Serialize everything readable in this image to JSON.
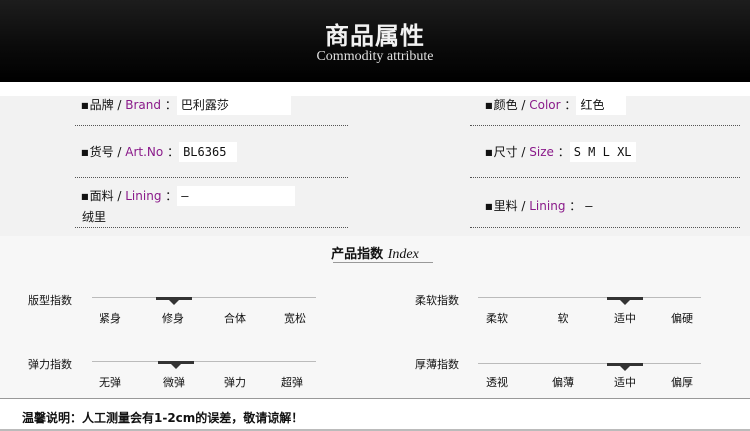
{
  "header": {
    "title": "商品属性",
    "subtitle": "Commodity attribute"
  },
  "attributes": {
    "bullet": "■",
    "brand": {
      "cn": "品牌",
      "sep": " / ",
      "en": "Brand",
      "colon": "：",
      "value": "巴利露莎"
    },
    "color": {
      "cn": "颜色",
      "sep": " / ",
      "en": "Color",
      "colon": "：",
      "value": "红色"
    },
    "art": {
      "cn": "货号",
      "sep": " / ",
      "en": "Art.No",
      "colon": "：",
      "value": "BL6365"
    },
    "size": {
      "cn": "尺寸",
      "sep": " / ",
      "en": "Size",
      "colon": "：",
      "value": "S M L XL"
    },
    "fabric": {
      "cn": "面料",
      "sep": " / ",
      "en": "Lining",
      "colon": "：",
      "value": "–",
      "value_cont": "绒里"
    },
    "lining": {
      "cn": "里料",
      "sep": " / ",
      "en": "Lining",
      "colon": "：",
      "value": "–"
    }
  },
  "index": {
    "title_cn": "产品指数",
    "title_en": "Index",
    "rows": [
      {
        "label": "版型指数",
        "options": [
          "紧身",
          "修身",
          "合体",
          "宽松"
        ],
        "selected": 1
      },
      {
        "label": "柔软指数",
        "options": [
          "柔软",
          "软",
          "适中",
          "偏硬"
        ],
        "selected": 2
      },
      {
        "label": "弹力指数",
        "options": [
          "无弹",
          "微弹",
          "弹力",
          "超弹"
        ],
        "selected": 1
      },
      {
        "label": "厚薄指数",
        "options": [
          "透视",
          "偏薄",
          "适中",
          "偏厚"
        ],
        "selected": 2
      }
    ]
  },
  "note": "温馨说明：人工测量会有1-2cm的误差，敬请谅解！"
}
